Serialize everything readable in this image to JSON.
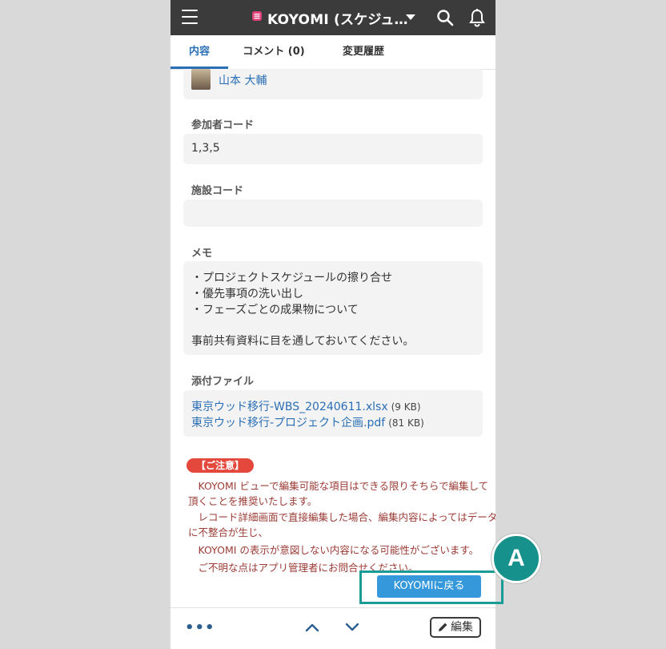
{
  "appbar": {
    "title": "KOYOMI (スケジュ…",
    "brand_color": "#e0417a"
  },
  "tabs": [
    {
      "label": "内容",
      "active": true
    },
    {
      "label": "コメント (0)",
      "active": false
    },
    {
      "label": "変更履歴",
      "active": false
    }
  ],
  "fields": {
    "owner_name": "山本 大輔",
    "participant_code_label": "参加者コード",
    "participant_code_value": "1,3,5",
    "facility_code_label": "施設コード",
    "facility_code_value": "",
    "memo_label": "メモ",
    "memo_lines": [
      "・プロジェクトスケジュールの擦り合せ",
      "・優先事項の洗い出し",
      "・フェーズごとの成果物について",
      "",
      "事前共有資料に目を通しておいてください。"
    ],
    "attachments_label": "添付ファイル",
    "attachments": [
      {
        "name": "東京ウッド移行-WBS_20240611.xlsx",
        "size": "(9 KB)"
      },
      {
        "name": "東京ウッド移行-プロジェクト企画.pdf",
        "size": "(81 KB)"
      }
    ]
  },
  "notice": {
    "badge": "【ご注意】",
    "lines": [
      "　KOYOMI ビューで編集可能な項目はできる限りそちらで編集して",
      "頂くことを推奨いたします。",
      "　レコード詳細画面で直接編集した場合、編集内容によってはデータ",
      "に不整合が生じ、",
      "　KOYOMI の表示が意図しない内容になる可能性がございます。",
      "　ご不明な点はアプリ管理者にお問合せください。"
    ]
  },
  "back_button_label": "KOYOMIに戻る",
  "bottombar": {
    "more": "•••",
    "edit_label": "編集"
  },
  "annotation": {
    "marker_label": "A",
    "color": "#1a9b96"
  }
}
